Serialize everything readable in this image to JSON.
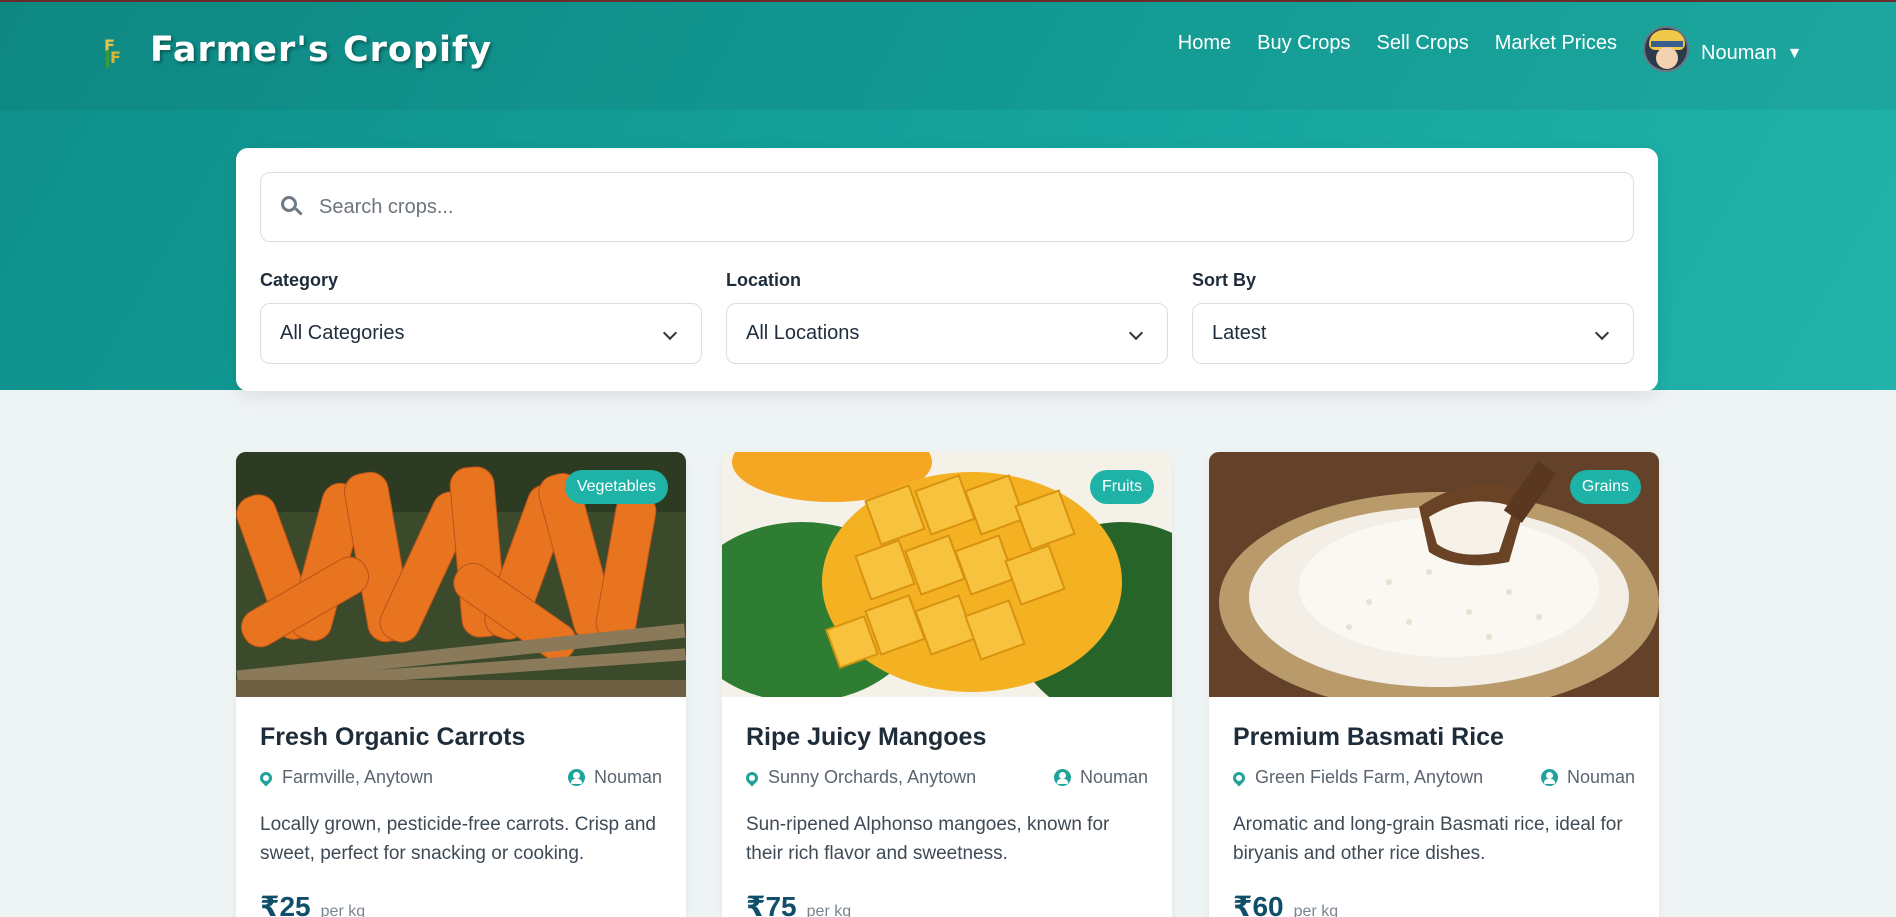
{
  "brand": {
    "name": "Farmer's Cropify",
    "logo_letters": [
      "F",
      "F"
    ]
  },
  "nav": {
    "links": [
      "Home",
      "Buy Crops",
      "Sell Crops",
      "Market Prices"
    ],
    "user": {
      "name": "Nouman"
    }
  },
  "search": {
    "placeholder": "Search crops..."
  },
  "filters": [
    {
      "label": "Category",
      "value": "All Categories"
    },
    {
      "label": "Location",
      "value": "All Locations"
    },
    {
      "label": "Sort By",
      "value": "Latest"
    }
  ],
  "crops": [
    {
      "title": "Fresh Organic Carrots",
      "category": "Vegetables",
      "location": "Farmville, Anytown",
      "seller": "Nouman",
      "description": "Locally grown, pesticide-free carrots. Crisp and sweet, perfect for snacking or cooking.",
      "price": "₹25",
      "unit": "per kg"
    },
    {
      "title": "Ripe Juicy Mangoes",
      "category": "Fruits",
      "location": "Sunny Orchards, Anytown",
      "seller": "Nouman",
      "description": "Sun-ripened Alphonso mangoes, known for their rich flavor and sweetness.",
      "price": "₹75",
      "unit": "per kg"
    },
    {
      "title": "Premium Basmati Rice",
      "category": "Grains",
      "location": "Green Fields Farm, Anytown",
      "seller": "Nouman",
      "description": "Aromatic and long-grain Basmati rice, ideal for biryanis and other rice dishes.",
      "price": "₹60",
      "unit": "per kg"
    }
  ],
  "colors": {
    "header_primary": "#0f8f8a",
    "header_secondary": "#21b3aa",
    "accent": "#1fb2a6",
    "page_bg": "#eef3f3"
  }
}
